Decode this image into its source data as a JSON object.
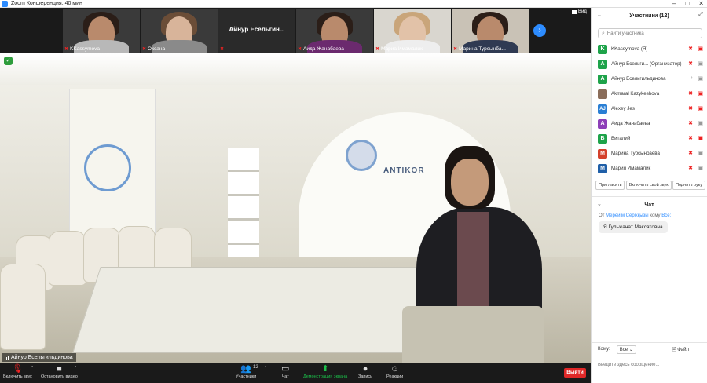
{
  "window": {
    "title": "Zoom Конференция. 40 мин"
  },
  "thumbnails": [
    {
      "name": "KKassymova",
      "muted": true
    },
    {
      "name": "Оксана",
      "muted": true
    },
    {
      "name": "Айнур  Есельгин...",
      "muted": true,
      "name_only": true
    },
    {
      "name": "Аида Жанабаева",
      "muted": true
    },
    {
      "name": "Мариа Имамалик",
      "muted": true
    },
    {
      "name": "Марина Турсынба...",
      "muted": true
    }
  ],
  "view_label": "Вид",
  "main": {
    "active_speaker": "Айнур Есельгильдинова",
    "logo_text": "ANTIKOR"
  },
  "toolbar": {
    "unmute": "Включить звук",
    "start_video": "Остановить видео",
    "participants": "Участники",
    "participants_count": "12",
    "chat": "Чат",
    "share": "Демонстрация экрана",
    "record": "Запись",
    "reactions": "Реакции",
    "leave": "Выйти"
  },
  "panel": {
    "title": "Участники (12)",
    "search_placeholder": "Найти участника",
    "participants": [
      {
        "initial": "K",
        "color": "#1ea34a",
        "name": "KKassymova (Я)",
        "mic": "off",
        "cam": "off"
      },
      {
        "initial": "A",
        "color": "#1ea34a",
        "name": "Айнур Есельги... (Организатор)",
        "mic": "off",
        "cam": "on"
      },
      {
        "initial": "A",
        "color": "#1ea34a",
        "name": "Айнур Есельгильдинова",
        "mic": "on",
        "cam": "on"
      },
      {
        "initial": "",
        "color": "#8a6d5a",
        "name": "Akmaral Kazykeshova",
        "mic": "off",
        "cam": "off"
      },
      {
        "initial": "AJ",
        "color": "#2a7fd4",
        "name": "Alexey Jes",
        "mic": "off",
        "cam": "off"
      },
      {
        "initial": "А",
        "color": "#8d3fb8",
        "name": "Аида Жанабаева",
        "mic": "off",
        "cam": "on"
      },
      {
        "initial": "В",
        "color": "#1ea34a",
        "name": "Виталий",
        "mic": "off",
        "cam": "off"
      },
      {
        "initial": "М",
        "color": "#d4402b",
        "name": "Марина Турсынбаева",
        "mic": "off",
        "cam": "on"
      },
      {
        "initial": "М",
        "color": "#1f5fa8",
        "name": "Мария Имамалик",
        "mic": "off",
        "cam": "on"
      }
    ],
    "invite": "Пригласить",
    "unmute_me": "Включить свой звук",
    "raise_hand": "Поднять руку"
  },
  "chat": {
    "title": "Чат",
    "from_prefix": "От",
    "from": "Мерейім Серікқызы",
    "to_prefix": "кому",
    "to": "Все:",
    "message": "Я Гульжанат Максатовна",
    "to_label": "Кому:",
    "to_value": "Все",
    "file": "Файл",
    "input_placeholder": "Введите здесь сообщение..."
  }
}
